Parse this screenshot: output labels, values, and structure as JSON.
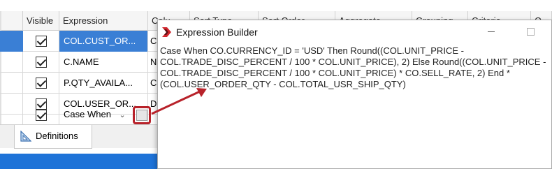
{
  "grid": {
    "columns": [
      {
        "label": ""
      },
      {
        "label": "Visible"
      },
      {
        "label": "Expression"
      },
      {
        "label": "Colu"
      },
      {
        "label": "Sort Type"
      },
      {
        "label": "Sort Order"
      },
      {
        "label": "Aggregate"
      },
      {
        "label": "Grouping"
      },
      {
        "label": "Criteria"
      },
      {
        "label": "O"
      }
    ],
    "rows": [
      {
        "visible": true,
        "expression": "COL.CUST_OR...",
        "col3": "C",
        "selected": true
      },
      {
        "visible": true,
        "expression": "C.NAME",
        "col3": "N",
        "selected": false
      },
      {
        "visible": true,
        "expression": "P.QTY_AVAILA...",
        "col3": "C",
        "selected": false
      },
      {
        "visible": true,
        "expression": "COL.USER_OR...",
        "col3": "D",
        "selected": false
      },
      {
        "visible": true,
        "expression": "Case When",
        "col3": "",
        "selected": false
      }
    ],
    "combo_arrow": "⌄"
  },
  "tabs": {
    "definitions_label": "Definitions"
  },
  "dialog": {
    "title": "Expression Builder",
    "expression": "Case When CO.CURRENCY_ID = 'USD' Then Round((COL.UNIT_PRICE -\nCOL.TRADE_DISC_PERCENT / 100 * COL.UNIT_PRICE), 2) Else Round((COL.UNIT_PRICE -\nCOL.TRADE_DISC_PERCENT / 100 * COL.UNIT_PRICE) * CO.SELL_RATE, 2) End *\n(COL.USER_ORDER_QTY - COL.TOTAL_USR_SHIP_QTY)"
  },
  "colors": {
    "accent_blue": "#3a7fd5",
    "highlight_red": "#b8222a",
    "status_bar_blue": "#1e73d8"
  },
  "icons": {
    "dialog_logo": "red-chevron-logo",
    "definitions_tab_icon": "triangle-ruler-icon",
    "checkbox": "checked-checkbox"
  }
}
